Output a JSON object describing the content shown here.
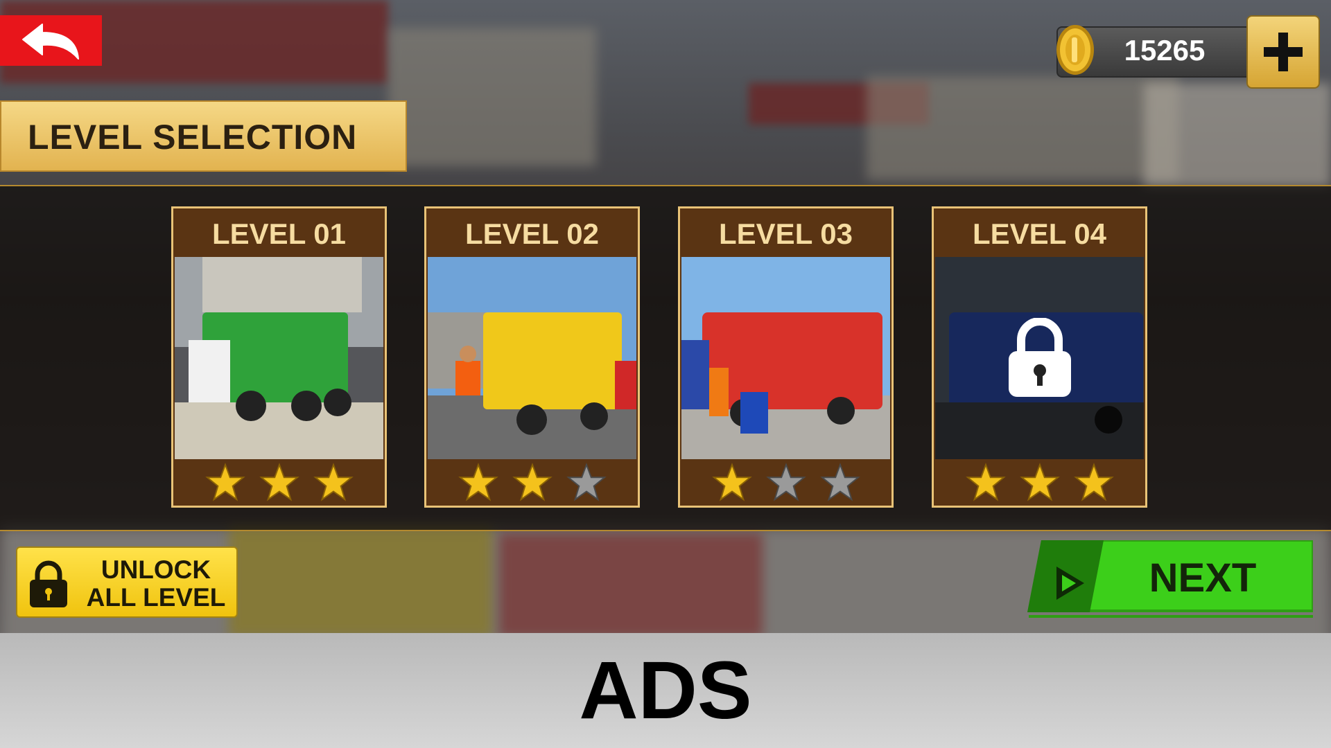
{
  "top_bar": {
    "back_icon": "back-arrow-icon",
    "coins": "15265",
    "add_coins_icon": "plus-icon"
  },
  "title": "LEVEL SELECTION",
  "levels": [
    {
      "label": "LEVEL 01",
      "stars_earned": 3,
      "stars_total": 3,
      "locked": false,
      "truck_color": "#2fa23a"
    },
    {
      "label": "LEVEL 02",
      "stars_earned": 2,
      "stars_total": 3,
      "locked": false,
      "truck_color": "#f0c81a"
    },
    {
      "label": "LEVEL 03",
      "stars_earned": 1,
      "stars_total": 3,
      "locked": false,
      "truck_color": "#d8322a"
    },
    {
      "label": "LEVEL 04",
      "stars_earned": 3,
      "stars_total": 3,
      "locked": true,
      "truck_color": "#2a49a8"
    }
  ],
  "unlock_button": {
    "line1": "UNLOCK",
    "line2": "ALL LEVEL",
    "icon": "padlock-icon"
  },
  "next_button": {
    "label": "NEXT",
    "icon": "play-icon"
  },
  "ads_label": "ADS",
  "colors": {
    "back_red": "#e8151b",
    "gold": "#e2b350",
    "card_brown": "#5a3413",
    "star_gold": "#f4c21c",
    "star_grey": "#9a9a9a",
    "next_green": "#3ccf1a",
    "unlock_yellow": "#f0c30e"
  }
}
